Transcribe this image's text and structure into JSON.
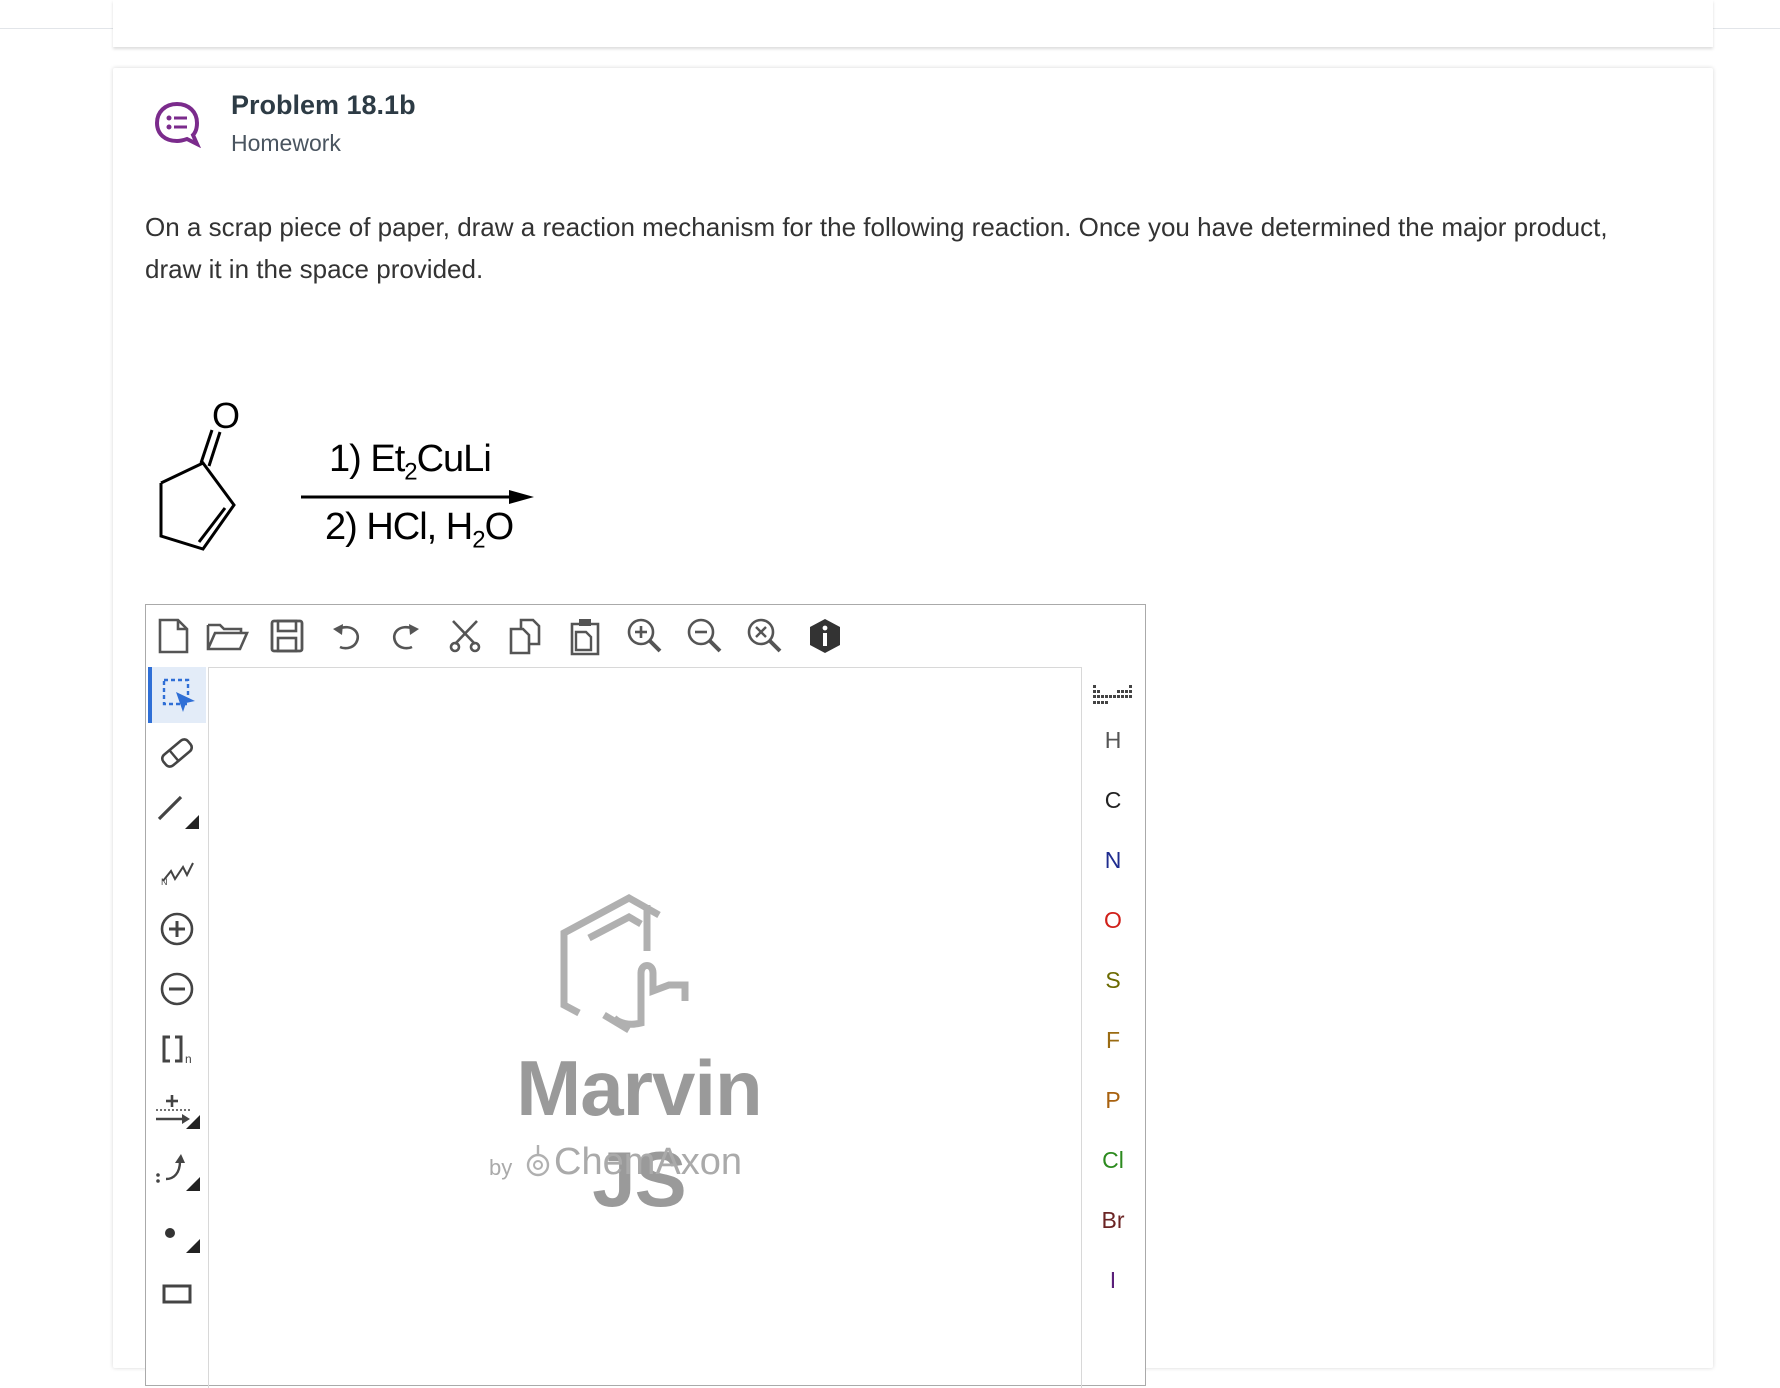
{
  "assignment": {
    "title": "Problem 18.1b",
    "type": "Homework"
  },
  "question": {
    "text": "On a scrap piece of paper, draw a reaction mechanism for the following reaction. Once you have determined the major product, draw it in the space provided."
  },
  "reaction": {
    "reactant_atom_label": "O",
    "step1_prefix": "1) Et",
    "step1_sub": "2",
    "step1_suffix": "CuLi",
    "step2_prefix": "2) HCl, H",
    "step2_sub": "2",
    "step2_suffix": "O"
  },
  "editor": {
    "logo_name": "Marvin JS",
    "logo_by": "by",
    "logo_company": "ChemAxon",
    "toolbar_icons": [
      "new-document-icon",
      "open-folder-icon",
      "save-icon",
      "undo-icon",
      "redo-icon",
      "cut-icon",
      "copy-icon",
      "paste-icon",
      "zoom-in-icon",
      "zoom-out-icon",
      "zoom-reset-icon",
      "info-icon"
    ],
    "left_tools": [
      "select-icon",
      "eraser-icon",
      "single-bond-icon",
      "chain-icon",
      "positive-charge-icon",
      "negative-charge-icon",
      "bracket-icon",
      "reaction-arrow-icon",
      "electron-flow-icon",
      "radical-icon",
      "rectangle-icon"
    ],
    "bracket_sub": "n",
    "elements": [
      {
        "symbol": "H",
        "color": "#555555"
      },
      {
        "symbol": "C",
        "color": "#222222"
      },
      {
        "symbol": "N",
        "color": "#1f2d8f"
      },
      {
        "symbol": "O",
        "color": "#d0201a"
      },
      {
        "symbol": "S",
        "color": "#6b6a00"
      },
      {
        "symbol": "F",
        "color": "#9a6b12"
      },
      {
        "symbol": "P",
        "color": "#a8610f"
      },
      {
        "symbol": "Cl",
        "color": "#2c8a1e"
      },
      {
        "symbol": "Br",
        "color": "#6b2424"
      },
      {
        "symbol": "I",
        "color": "#5a1f7a"
      }
    ]
  },
  "colors": {
    "accent": "#2f6fd6",
    "header_icon": "#7b2b8c"
  }
}
